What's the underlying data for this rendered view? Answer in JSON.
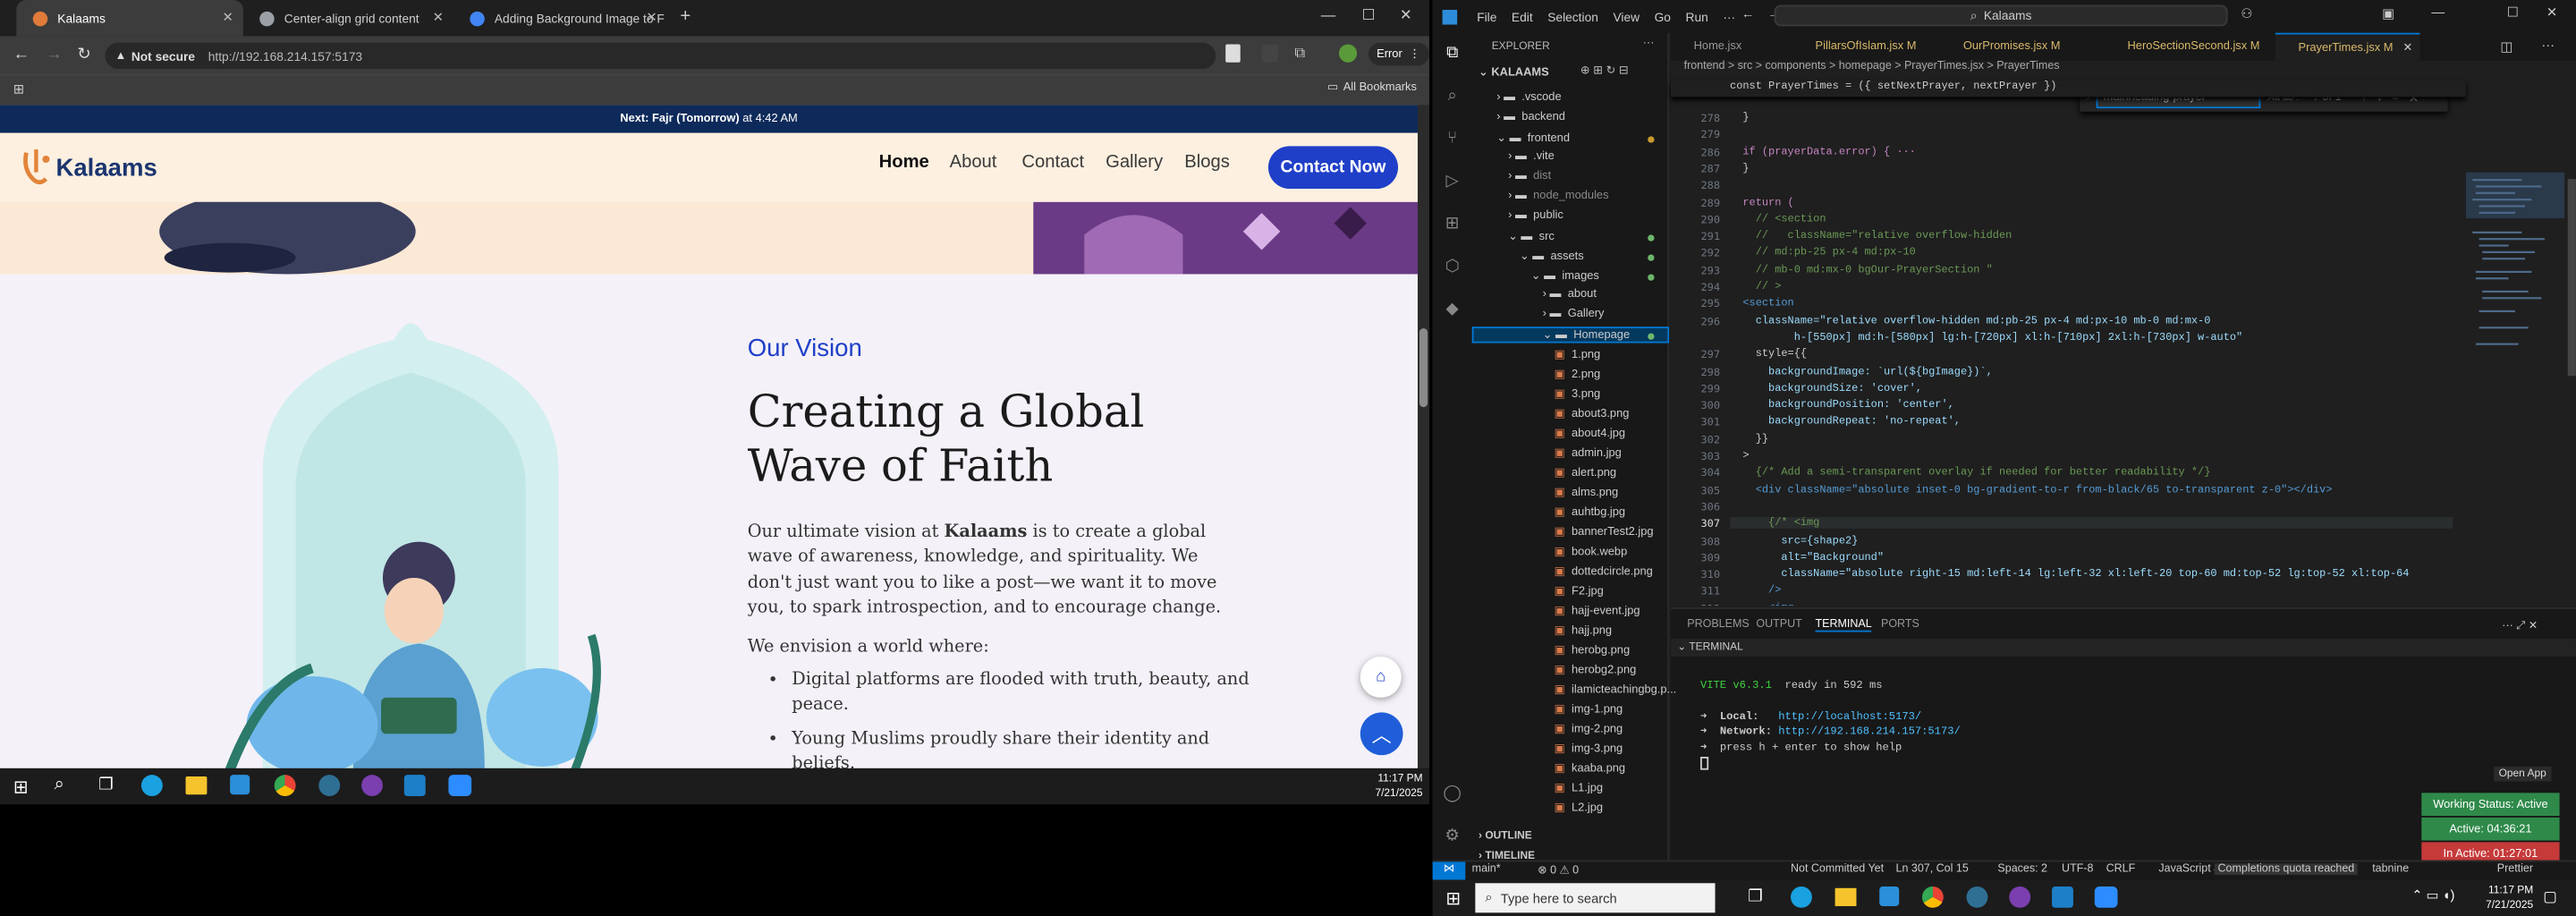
{
  "chrome": {
    "tabs": [
      {
        "label": "Kalaams"
      },
      {
        "label": "Center-align grid content"
      },
      {
        "label": "Adding Background Image to F"
      }
    ],
    "security": "Not secure",
    "url": "http://192.168.214.157:5173",
    "error_label": "Error",
    "all_bookmarks": "All Bookmarks"
  },
  "site": {
    "banner_prefix": "Next:",
    "banner_prayer": "Fajr (Tomorrow)",
    "banner_time": "at 4:42 AM",
    "logo_text": "Kalaams",
    "nav": [
      "Home",
      "About",
      "Contact",
      "Gallery",
      "Blogs"
    ],
    "contact_btn": "Contact Now",
    "eyebrow": "Our Vision",
    "heading_line1": "Creating a Global",
    "heading_line2": "Wave of Faith",
    "para_before": "Our ultimate vision at ",
    "para_bold": "Kalaams",
    "para_after": " is to create a global wave of awareness, knowledge, and spirituality. We don't just want you to like a post—we want it to move you, to spark introspection, and to encourage change.",
    "envision": "We envision a world where:",
    "bullets": [
      "Digital platforms are flooded with truth, beauty, and peace.",
      "Young Muslims proudly share their identity and beliefs."
    ]
  },
  "taskbar_left": {
    "time": "11:17 PM",
    "date": "7/21/2025"
  },
  "vscode": {
    "menu": [
      "File",
      "Edit",
      "Selection",
      "View",
      "Go",
      "Run",
      "···"
    ],
    "search": "Kalaams",
    "explorer_title": "EXPLORER",
    "root": "KALAAMS",
    "folders": [
      ".vscode",
      "backend",
      "frontend",
      ".vite",
      "dist",
      "node_modules",
      "public",
      "src",
      "assets",
      "images",
      "about",
      "Gallery",
      "Homepage"
    ],
    "files": [
      "1.png",
      "2.png",
      "3.png",
      "about3.png",
      "about4.jpg",
      "admin.jpg",
      "alert.png",
      "alms.png",
      "auhtbg.jpg",
      "bannerTest2.jpg",
      "book.webp",
      "dottedcircle.png",
      "F2.jpg",
      "hajj-event.jpg",
      "hajj.png",
      "herobg.png",
      "herobg2.png",
      "ilamicteachingbg.p...",
      "img-1.png",
      "img-2.png",
      "img-3.png",
      "kaaba.png",
      "L1.jpg",
      "L2.jpg"
    ],
    "outline": "OUTLINE",
    "timeline": "TIMELINE",
    "editor_tabs": [
      {
        "label": "Home.jsx"
      },
      {
        "label": "PillarsOfIslam.jsx M"
      },
      {
        "label": "OurPromises.jsx M"
      },
      {
        "label": "HeroSectionSecond.jsx M"
      },
      {
        "label": "PrayerTimes.jsx M"
      }
    ],
    "breadcrumb": "frontend > src > components > homepage > PrayerTimes.jsx > PrayerTimes",
    "sticky": "const PrayerTimes = ({ setNextPrayer, nextPrayer })",
    "find_query": "mainheading-prayer",
    "find_count": "? of 1",
    "lines": [
      {
        "n": "278",
        "t": "  }"
      },
      {
        "n": "279",
        "t": ""
      },
      {
        "n": "286",
        "t": "  if (prayerData.error) { ···"
      },
      {
        "n": "287",
        "t": "  }"
      },
      {
        "n": "288",
        "t": ""
      },
      {
        "n": "289",
        "t": "  return ("
      },
      {
        "n": "290",
        "t": "    // <section"
      },
      {
        "n": "291",
        "t": "    //   className=\"relative overflow-hidden"
      },
      {
        "n": "292",
        "t": "    // md:pb-25 px-4 md:px-10"
      },
      {
        "n": "293",
        "t": "    // mb-0 md:mx-0 bgOur-PrayerSection \""
      },
      {
        "n": "294",
        "t": "    // >"
      },
      {
        "n": "295",
        "t": "  <section"
      },
      {
        "n": "296",
        "t": "    className=\"relative overflow-hidden md:pb-25 px-4 md:px-10 mb-0 md:mx-0"
      },
      {
        "n": "",
        "t": "          h-[550px] md:h-[580px] lg:h-[720px] xl:h-[710px] 2xl:h-[730px] w-auto\""
      },
      {
        "n": "297",
        "t": "    style={{"
      },
      {
        "n": "298",
        "t": "      backgroundImage: `url(${bgImage})`,"
      },
      {
        "n": "299",
        "t": "      backgroundSize: 'cover',"
      },
      {
        "n": "300",
        "t": "      backgroundPosition: 'center',"
      },
      {
        "n": "301",
        "t": "      backgroundRepeat: 'no-repeat',"
      },
      {
        "n": "302",
        "t": "    }}"
      },
      {
        "n": "303",
        "t": "  >"
      },
      {
        "n": "304",
        "t": "    {/* Add a semi-transparent overlay if needed for better readability */}"
      },
      {
        "n": "305",
        "t": "    <div className=\"absolute inset-0 bg-gradient-to-r from-black/65 to-transparent z-0\"></div>"
      },
      {
        "n": "306",
        "t": ""
      },
      {
        "n": "307",
        "t": "      {/* <img"
      },
      {
        "n": "308",
        "t": "        src={shape2}"
      },
      {
        "n": "309",
        "t": "        alt=\"Background\""
      },
      {
        "n": "310",
        "t": "        className=\"absolute right-15 md:left-14 lg:left-32 xl:left-20 top-60 md:top-52 lg:top-52 xl:top-64"
      },
      {
        "n": "311",
        "t": "      />"
      },
      {
        "n": "312",
        "t": "      <img"
      }
    ],
    "panel_tabs": [
      "PROBLEMS",
      "OUTPUT",
      "TERMINAL",
      "PORTS"
    ],
    "terminal_title": "TERMINAL",
    "terminal": {
      "vite": "VITE v6.3.1",
      "ready": "ready in 592 ms",
      "local_label": "Local:",
      "local_url": "http://localhost:5173/",
      "network_label": "Network:",
      "network_url": "http://192.168.214.157:5173/",
      "help": "press h + enter to show help"
    },
    "open_app": "Open App",
    "working_status": "Working Status: Active",
    "active_time": "Active: 04:36:21",
    "inactive_time": "In Active: 01:27:01",
    "status": {
      "branch": "main*",
      "problems": "⊗ 0 ⚠ 0",
      "commit": "Not Committed Yet",
      "position": "Ln 307, Col 15",
      "spaces": "Spaces: 2",
      "encoding": "UTF-8",
      "eol": "CRLF",
      "lang": "JavaScript JSX",
      "quota": "Completions quota reached",
      "tabnine": "tabnine",
      "prettier": "Prettier"
    }
  },
  "taskbar_right": {
    "search_placeholder": "Type here to search",
    "time": "11:17 PM",
    "date": "7/21/2025"
  }
}
